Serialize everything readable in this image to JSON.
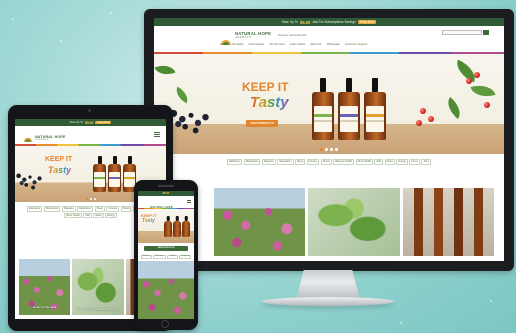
{
  "brand": {
    "name": "NATURAL HOPE",
    "subname": "HERBALS",
    "tagline": "Discover Herbal Benefits"
  },
  "promo": {
    "pre": "Save Up To",
    "amount": "$5.00",
    "post": "Ask For Subscriptions Savings",
    "cta": "Shop Now"
  },
  "nav": {
    "items": [
      "Home",
      "Products",
      "Herb Guides",
      "Our Process",
      "Learn Herbs",
      "About Us",
      "Wholesale",
      "Customer Support"
    ]
  },
  "hero": {
    "line1": "KEEP IT",
    "line2": "Tasty",
    "cta": "VIEW PRODUCTS"
  },
  "categories": [
    "Elderberry",
    "Mushrooms",
    "Digestive",
    "Respiratory",
    "Sleep",
    "Immune",
    "Stress",
    "Womens Health",
    "Mens Health",
    "Kids",
    "Detox",
    "Energy",
    "Focus",
    "Joint",
    "Skin",
    "Heart",
    "Liver",
    "Mood"
  ],
  "features": [
    {
      "caption": "Home to the Herb"
    },
    {
      "caption": "The process of nature to discover"
    },
    {
      "caption": "Wild Harvested"
    }
  ],
  "colors": {
    "accent": "#e2862d",
    "brand_green": "#3e6b3a",
    "promo_bg": "#2f5a36",
    "background": "#9fd6d3"
  }
}
